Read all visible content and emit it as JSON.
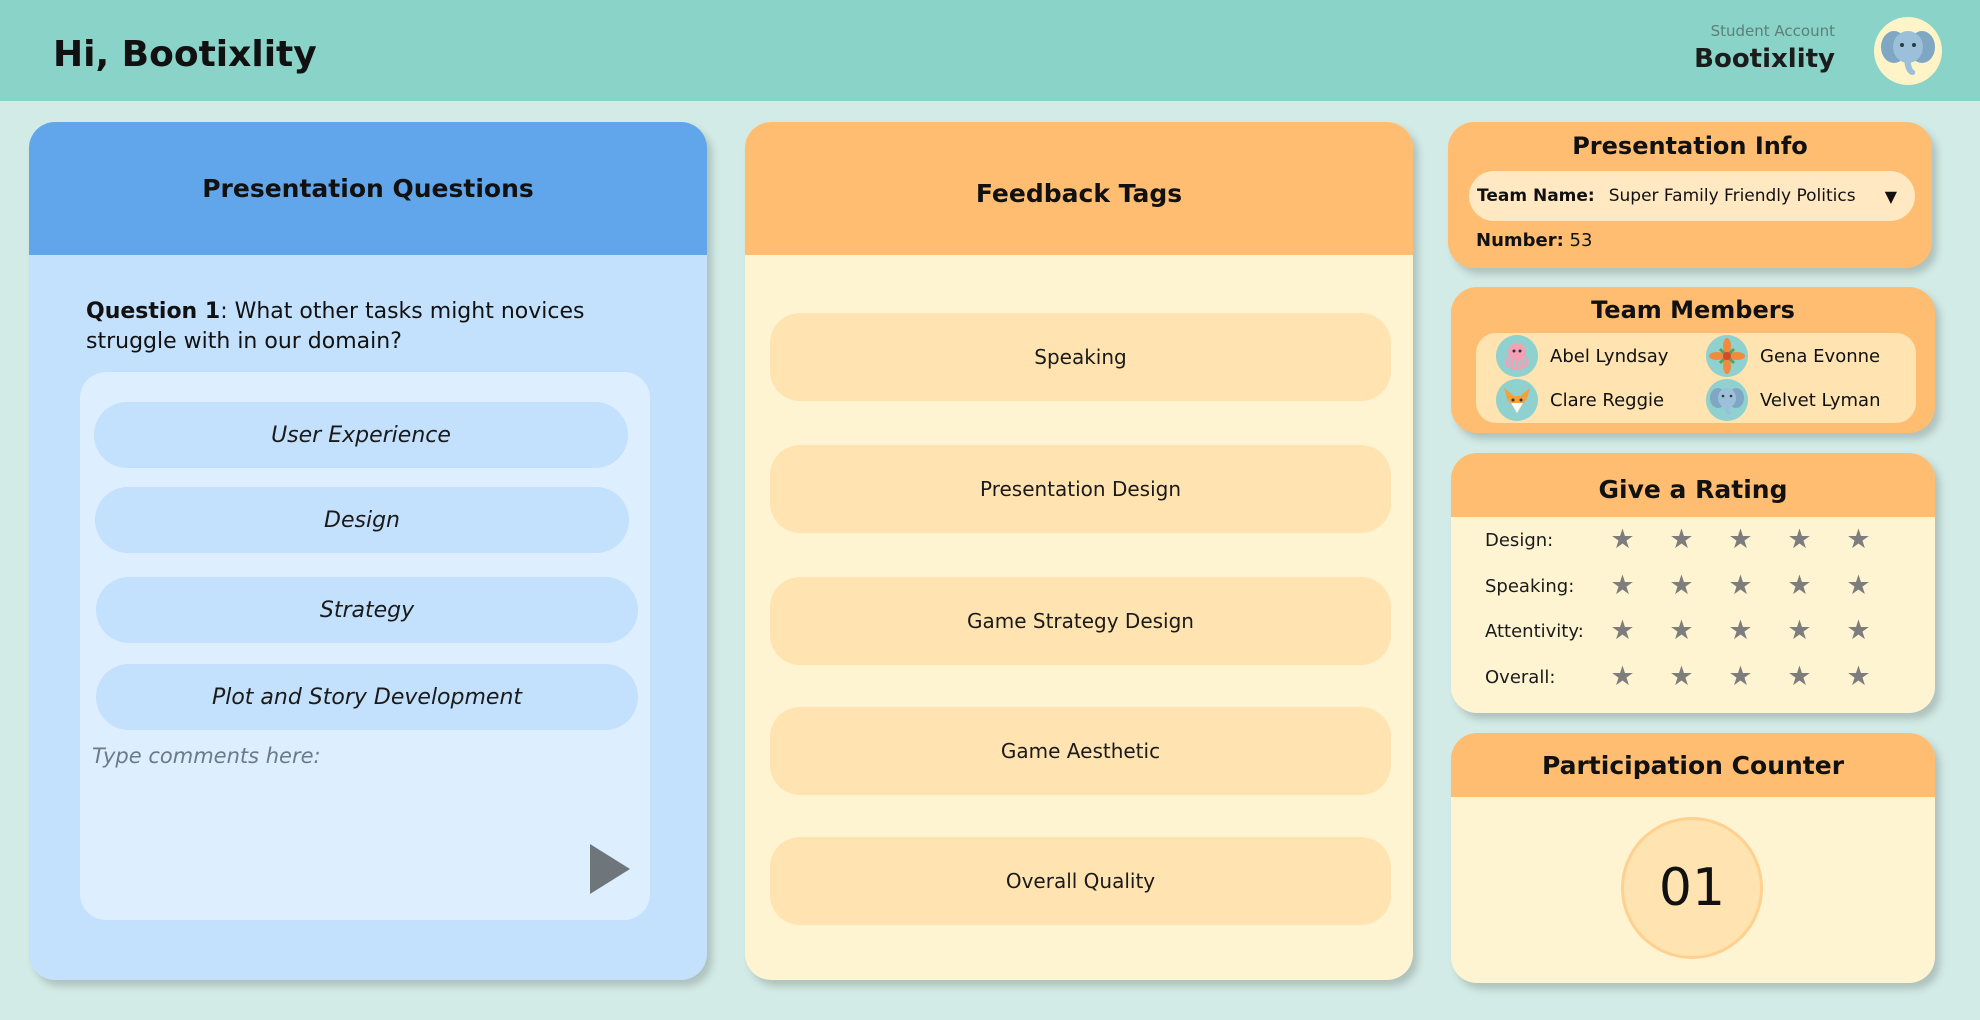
{
  "header": {
    "greeting": "Hi, Bootixlity",
    "account_label": "Student Account",
    "account_name": "Bootixlity",
    "avatar_icon": "elephant-icon"
  },
  "questions": {
    "title": "Presentation Questions",
    "question_label": "Question 1",
    "question_text": ": What other tasks might novices struggle with in our domain?",
    "tags": [
      "User Experience",
      "Design",
      "Strategy",
      "Plot and Story Development"
    ],
    "comment_placeholder": "Type comments here:",
    "send_icon": "play-icon"
  },
  "feedback": {
    "title": "Feedback Tags",
    "tags": [
      "Speaking",
      "Presentation Design",
      "Game Strategy Design",
      "Game Aesthetic",
      "Overall Quality"
    ]
  },
  "presentation_info": {
    "title": "Presentation Info",
    "team_label": "Team Name:",
    "team_value": "Super Family Friendly Politics",
    "dropdown_icon": "▼",
    "number_label": "Number:",
    "number_value": "53"
  },
  "team_members": {
    "title": "Team Members",
    "members": [
      {
        "name": "Abel Lyndsay",
        "icon": "octopus-icon"
      },
      {
        "name": "Gena Evonne",
        "icon": "flower-icon"
      },
      {
        "name": "Clare Reggie",
        "icon": "fox-icon"
      },
      {
        "name": "Velvet Lyman",
        "icon": "elephant-icon"
      }
    ]
  },
  "rating": {
    "title": "Give a Rating",
    "star_glyph": "★",
    "star_color": "#7d7d7d",
    "rows": [
      {
        "label": "Design:",
        "stars": 0
      },
      {
        "label": "Speaking:",
        "stars": 0
      },
      {
        "label": "Attentivity:",
        "stars": 0
      },
      {
        "label": "Overall:",
        "stars": 0
      }
    ]
  },
  "participation": {
    "title": "Participation Counter",
    "count": "01"
  },
  "colors": {
    "header_bg": "#89d3c9",
    "page_bg": "#d3ebe6",
    "blue_header": "#61a6ea",
    "blue_card": "#c3e1fd",
    "orange_header": "#ffbd72",
    "cream_card": "#fff4d2",
    "tag_orange": "#ffe3b0"
  }
}
